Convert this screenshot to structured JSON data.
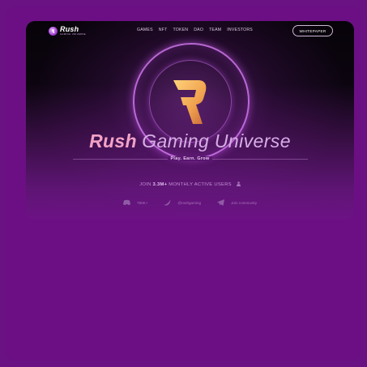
{
  "nav": {
    "logo": {
      "name": "Rush",
      "subtitle": "GAMING UNIVERSE"
    },
    "menu": [
      "GAMES",
      "NFT",
      "TOKEN",
      "DAO",
      "TEAM",
      "INVESTORS"
    ],
    "cta": "WHITEPAPER"
  },
  "hero": {
    "title_bold": "Rush",
    "title_light": "Gaming Universe",
    "tagline": "Play. Earn. Grow",
    "join_prefix": "JOIN",
    "join_count": "3.3M+",
    "join_suffix": "MONTHLY ACTIVE USERS"
  },
  "socials": [
    {
      "icon": "discord-icon",
      "label": "780K+"
    },
    {
      "icon": "twitter-icon",
      "label": "@rushgaming"
    },
    {
      "icon": "telegram-icon",
      "label": "Join community"
    }
  ],
  "colors": {
    "background": "#6a1183",
    "accent_pink": "#f2a2c6",
    "emblem": "#f2b15c"
  }
}
